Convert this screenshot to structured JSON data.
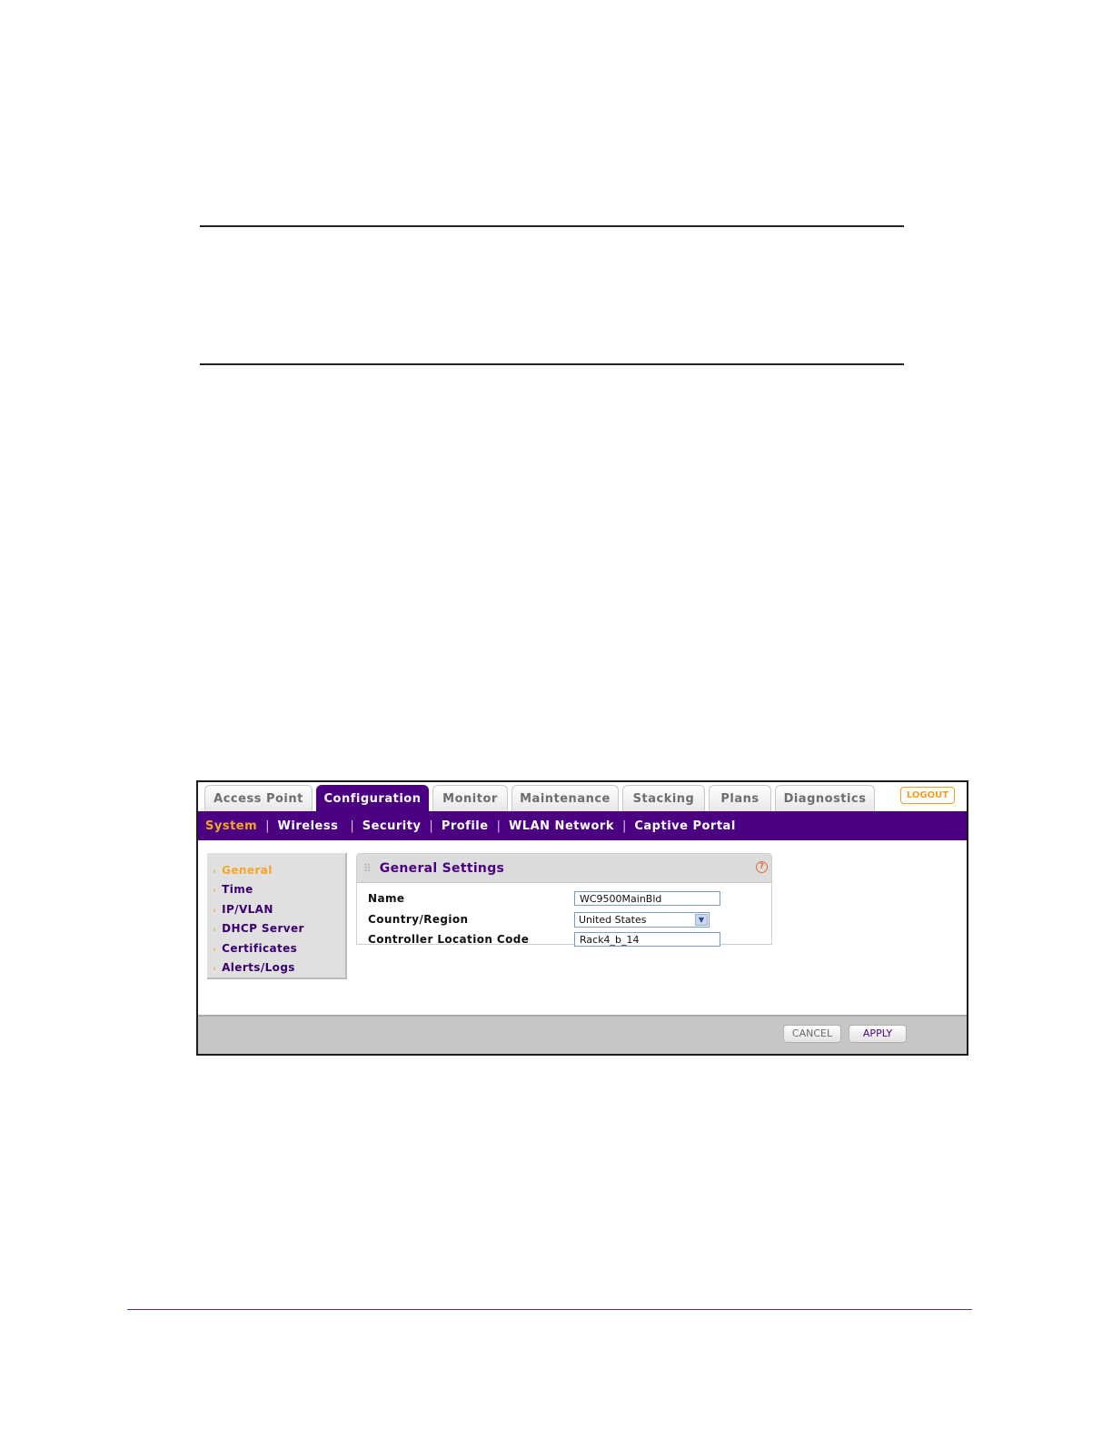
{
  "tabs": [
    {
      "label": "Access Point"
    },
    {
      "label": "Configuration"
    },
    {
      "label": "Monitor"
    },
    {
      "label": "Maintenance"
    },
    {
      "label": "Stacking"
    },
    {
      "label": "Plans"
    },
    {
      "label": "Diagnostics"
    }
  ],
  "active_tab": "Configuration",
  "logout_label": "LOGOUT",
  "subnav": [
    {
      "label": "System"
    },
    {
      "label": "Wireless"
    },
    {
      "label": "Security"
    },
    {
      "label": "Profile"
    },
    {
      "label": "WLAN Network"
    },
    {
      "label": "Captive Portal"
    }
  ],
  "active_subnav": "System",
  "sidemenu": [
    {
      "label": "General"
    },
    {
      "label": "Time"
    },
    {
      "label": "IP/VLAN"
    },
    {
      "label": "DHCP Server"
    },
    {
      "label": "Certificates"
    },
    {
      "label": "Alerts/Logs"
    }
  ],
  "active_sidemenu": "General",
  "panel": {
    "title": "General Settings",
    "help_symbol": "?",
    "fields": {
      "name": {
        "label": "Name",
        "value": "WC9500MainBld"
      },
      "country": {
        "label": "Country/Region",
        "value": "United States"
      },
      "location": {
        "label": "Controller Location Code",
        "value": "Rack4_b_14"
      }
    }
  },
  "buttons": {
    "cancel": "CANCEL",
    "apply": "APPLY"
  },
  "colors": {
    "accent": "#4b0082",
    "highlight": "#f5a623"
  },
  "icons": {
    "grip": "grip-icon",
    "help": "help-icon",
    "arrow": "chevron-right-icon",
    "dropdown": "chevron-down-icon"
  }
}
